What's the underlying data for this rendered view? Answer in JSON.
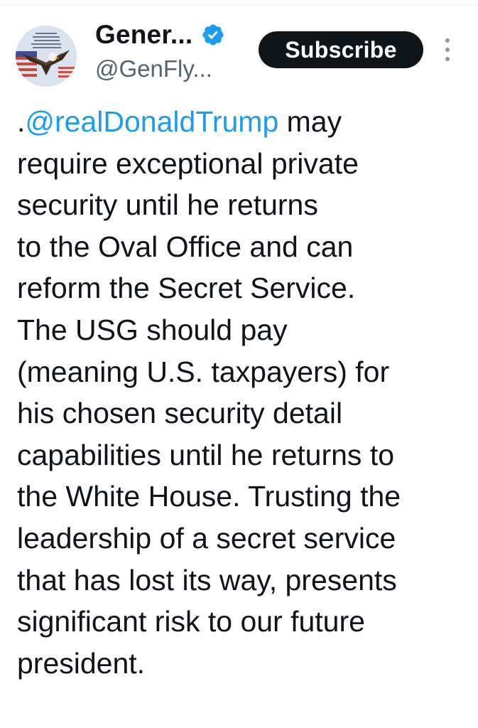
{
  "author": {
    "display_name": "Gener...",
    "handle": "@GenFly...",
    "verified": true,
    "avatar_icon": "eagle-flag-avatar-icon"
  },
  "actions": {
    "subscribe_label": "Subscribe",
    "more_icon": "more-vertical-icon"
  },
  "tweet": {
    "mention_prefix": ".",
    "mention": "@realDonaldTrump",
    "lines": [
      " may",
      "require exceptional private",
      "security until he returns",
      "to the Oval Office and can",
      "reform the Secret Service.",
      "The USG should pay",
      "(meaning U.S. taxpayers) for",
      "his chosen security detail",
      "capabilities until he returns to",
      "the White House. Trusting the",
      "leadership of a secret service",
      "that has lost its way, presents",
      "significant risk to our future",
      "president."
    ]
  },
  "colors": {
    "text": "#0f1419",
    "secondary": "#536471",
    "link": "#1d9bf0",
    "verified": "#1d9bf0",
    "button_bg": "#0f1419"
  }
}
